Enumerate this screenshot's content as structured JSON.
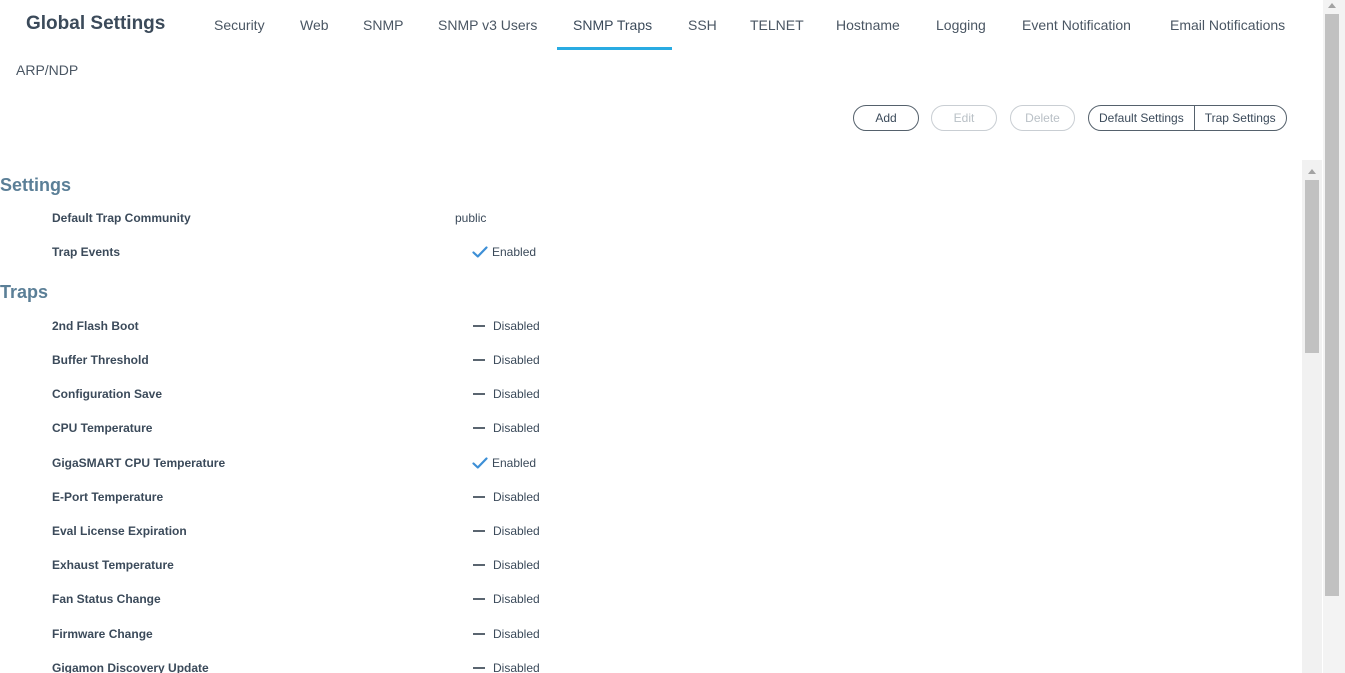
{
  "header": {
    "title": "Global Settings",
    "tabs": [
      {
        "label": "Security"
      },
      {
        "label": "Web"
      },
      {
        "label": "SNMP"
      },
      {
        "label": "SNMP v3 Users"
      },
      {
        "label": "SNMP Traps",
        "active": true
      },
      {
        "label": "SSH"
      },
      {
        "label": "TELNET"
      },
      {
        "label": "Hostname"
      },
      {
        "label": "Logging"
      },
      {
        "label": "Event Notification"
      },
      {
        "label": "Email Notifications"
      },
      {
        "label": "ARP/NDP"
      }
    ],
    "accent_color": "#29abe2"
  },
  "toolbar": {
    "add_label": "Add",
    "edit_label": "Edit",
    "delete_label": "Delete",
    "default_settings_label": "Default Settings",
    "trap_settings_label": "Trap Settings"
  },
  "settings": {
    "heading": "Settings",
    "rows": [
      {
        "label": "Default Trap Community",
        "value": "public"
      },
      {
        "label": "Trap Events",
        "value": "Enabled",
        "state": "enabled"
      }
    ]
  },
  "traps": {
    "heading": "Traps",
    "rows": [
      {
        "label": "2nd Flash Boot",
        "value": "Disabled",
        "state": "disabled"
      },
      {
        "label": "Buffer Threshold",
        "value": "Disabled",
        "state": "disabled"
      },
      {
        "label": "Configuration Save",
        "value": "Disabled",
        "state": "disabled"
      },
      {
        "label": "CPU Temperature",
        "value": "Disabled",
        "state": "disabled"
      },
      {
        "label": "GigaSMART CPU Temperature",
        "value": "Enabled",
        "state": "enabled"
      },
      {
        "label": "E-Port Temperature",
        "value": "Disabled",
        "state": "disabled"
      },
      {
        "label": "Eval License Expiration",
        "value": "Disabled",
        "state": "disabled"
      },
      {
        "label": "Exhaust Temperature",
        "value": "Disabled",
        "state": "disabled"
      },
      {
        "label": "Fan Status Change",
        "value": "Disabled",
        "state": "disabled"
      },
      {
        "label": "Firmware Change",
        "value": "Disabled",
        "state": "disabled"
      },
      {
        "label": "Gigamon Discovery Update",
        "value": "Disabled",
        "state": "disabled"
      }
    ]
  }
}
